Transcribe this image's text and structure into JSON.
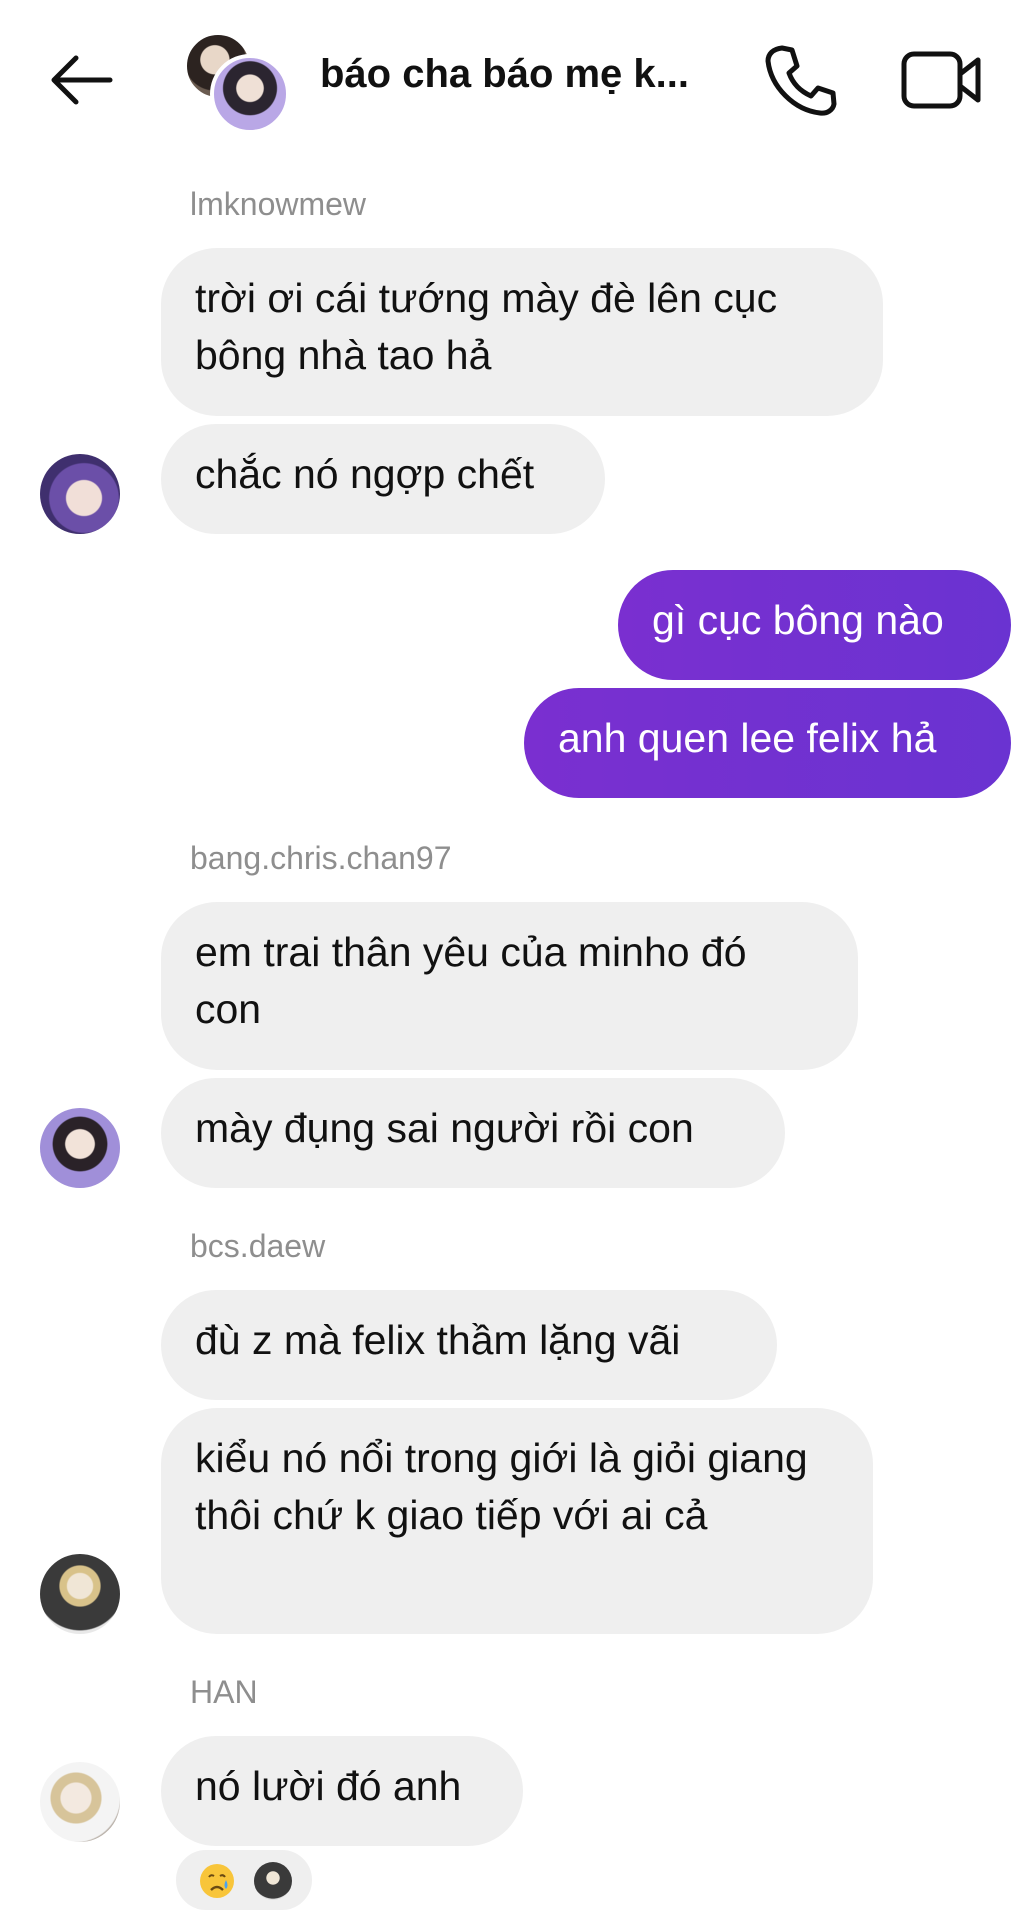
{
  "header": {
    "title": "báo cha báo mẹ k...",
    "back_icon": "arrow-left-icon",
    "call_icon": "phone-icon",
    "video_icon": "video-camera-icon"
  },
  "messages": [
    {
      "sender": "lmknowmew",
      "bubbles": [
        "trời ơi cái tướng mày đè lên cục bông nhà tao hả",
        "chắc nó ngợp chết"
      ]
    },
    {
      "outgoing": [
        "gì cục bông nào",
        "anh quen lee felix hả"
      ]
    },
    {
      "sender": "bang.chris.chan97",
      "bubbles": [
        "em trai thân yêu của minho đó con",
        "mày đụng sai người rồi con"
      ]
    },
    {
      "sender": "bcs.daew",
      "bubbles": [
        "đù z mà felix thầm lặng vãi",
        "kiểu nó nổi trong giới là giỏi giang thôi chứ k giao tiếp với ai cả"
      ]
    },
    {
      "sender": "HAN",
      "bubbles": [
        "nó lười đó anh"
      ],
      "reactions": [
        "crying-face-emoji",
        "reactor-avatar"
      ]
    }
  ],
  "colors": {
    "outgoing_bubble": "#6e2fcd",
    "incoming_bubble": "#efefef",
    "sender_name": "#8e8e8e"
  }
}
